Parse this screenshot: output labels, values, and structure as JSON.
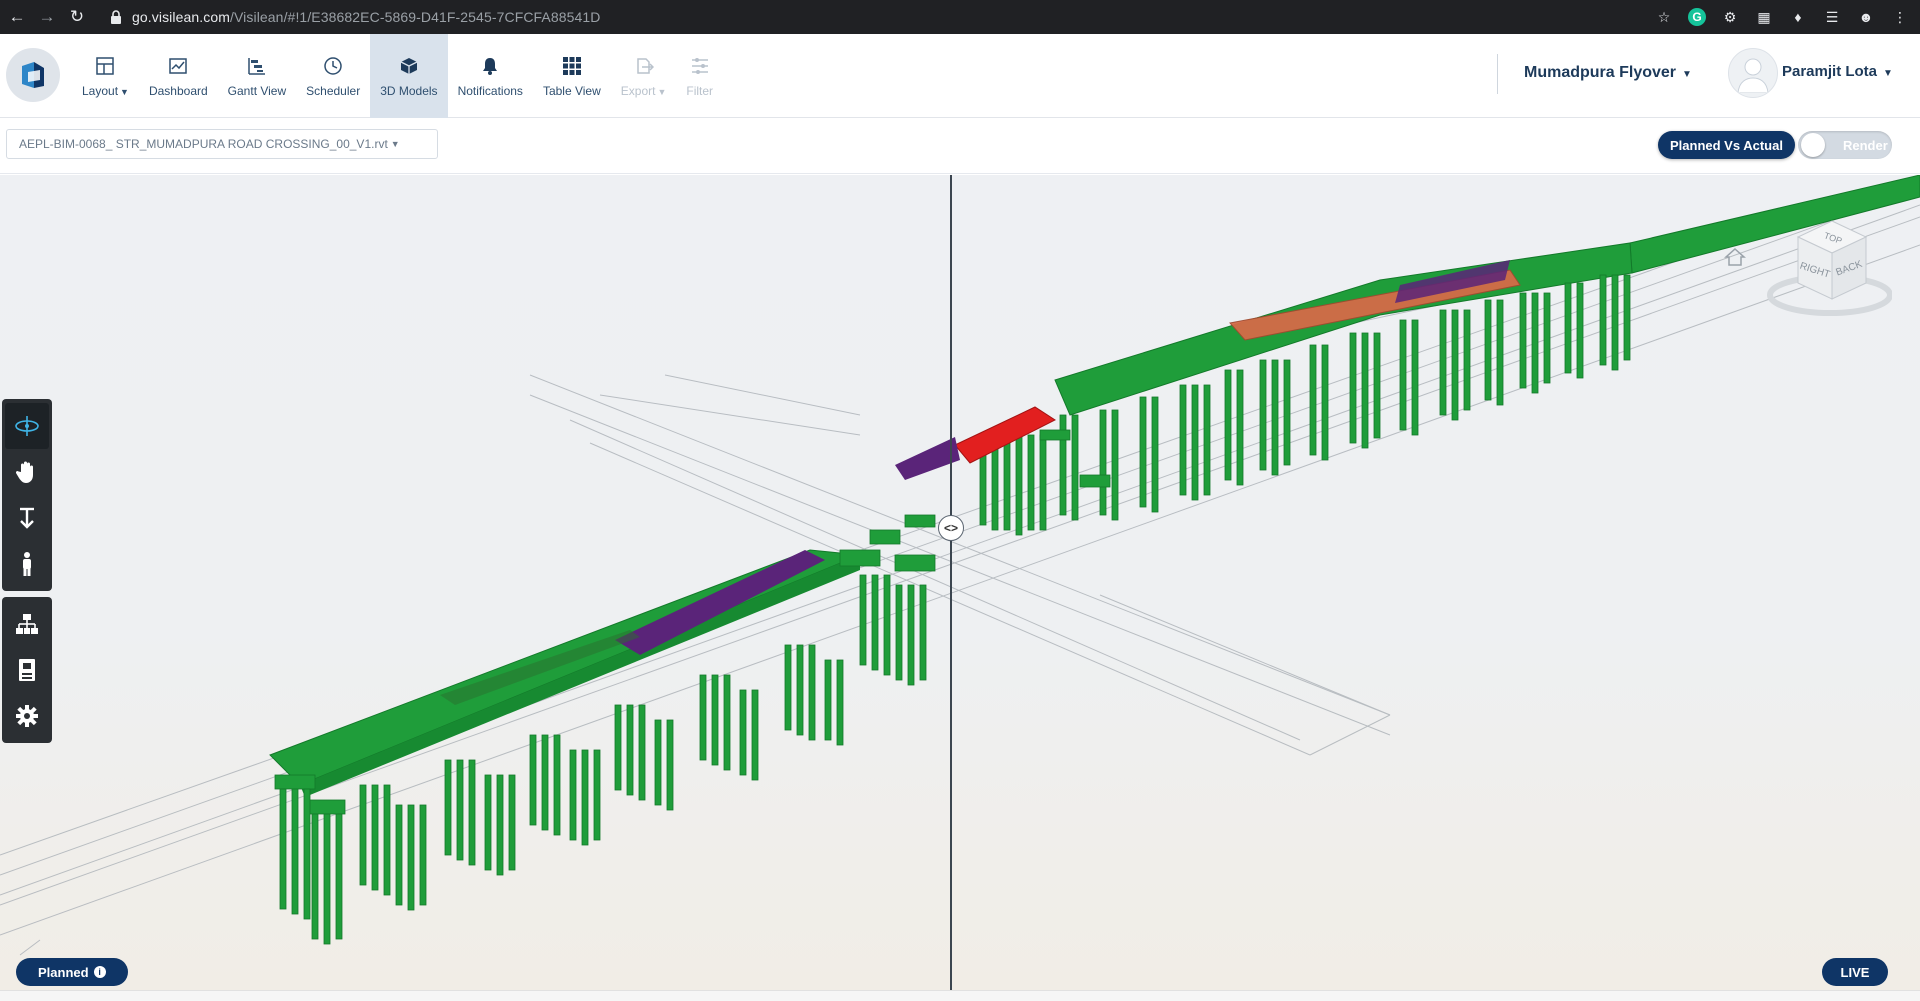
{
  "browser": {
    "url_host": "go.visilean.com",
    "url_path": "/Visilean/#!1/E38682EC-5869-D41F-2545-7CFCFA88541D"
  },
  "toolbar": {
    "items": [
      {
        "label": "Layout",
        "icon": "layout-icon",
        "dropdown": true
      },
      {
        "label": "Dashboard",
        "icon": "dashboard-icon"
      },
      {
        "label": "Gantt View",
        "icon": "gantt-icon"
      },
      {
        "label": "Scheduler",
        "icon": "clock-icon"
      },
      {
        "label": "3D Models",
        "icon": "cube-icon",
        "active": true
      },
      {
        "label": "Notifications",
        "icon": "bell-icon"
      },
      {
        "label": "Table View",
        "icon": "grid-icon"
      },
      {
        "label": "Export",
        "icon": "export-icon",
        "dropdown": true,
        "disabled": true
      },
      {
        "label": "Filter",
        "icon": "filter-icon",
        "disabled": true
      }
    ]
  },
  "project": {
    "name": "Mumadpura Flyover"
  },
  "user": {
    "name": "Paramjit Lota"
  },
  "model": {
    "selected": "AEPL-BIM-0068_ STR_MUMADPURA ROAD CROSSING_00_V1.rvt"
  },
  "view_controls": {
    "planned_vs_actual": "Planned Vs Actual",
    "render": "Render",
    "render_on": false
  },
  "viewcube": {
    "faces": [
      "TOP",
      "RIGHT",
      "BACK"
    ]
  },
  "status": {
    "planned": "Planned",
    "live": "LIVE"
  },
  "colors": {
    "brand_navy": "#0f3566",
    "completed_green": "#1f9d3a",
    "in_progress_purple": "#5a2479",
    "delayed_red": "#e21f1f",
    "pending_orange": "#d56b48"
  }
}
